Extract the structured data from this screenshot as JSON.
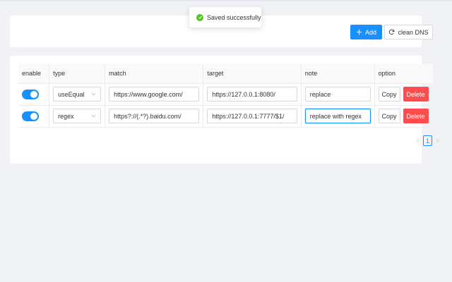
{
  "toast": {
    "message": "Saved successfully",
    "icon": "check-circle-icon",
    "color": "#52c41a"
  },
  "toolbar": {
    "add_label": "Add",
    "clean_dns_label": "clean DNS"
  },
  "table": {
    "headers": {
      "enable": "enable",
      "type": "type",
      "match": "match",
      "target": "target",
      "note": "note",
      "option": "option"
    },
    "rows": [
      {
        "enabled": true,
        "type": "useEqual",
        "match": "https://www.google.com/",
        "target": "https://127.0.0.1:8080/",
        "note": "replace",
        "copy": "Copy",
        "delete": "Delete"
      },
      {
        "enabled": true,
        "type": "regex",
        "match": "https?://(.*?).baidu.com/",
        "target": "https://127.0.0.1:7777/$1/",
        "note": "replace with regex",
        "copy": "Copy",
        "delete": "Delete"
      }
    ]
  },
  "pagination": {
    "current": "1"
  },
  "colors": {
    "primary": "#1890ff",
    "danger": "#ff4d4f",
    "success": "#52c41a"
  }
}
